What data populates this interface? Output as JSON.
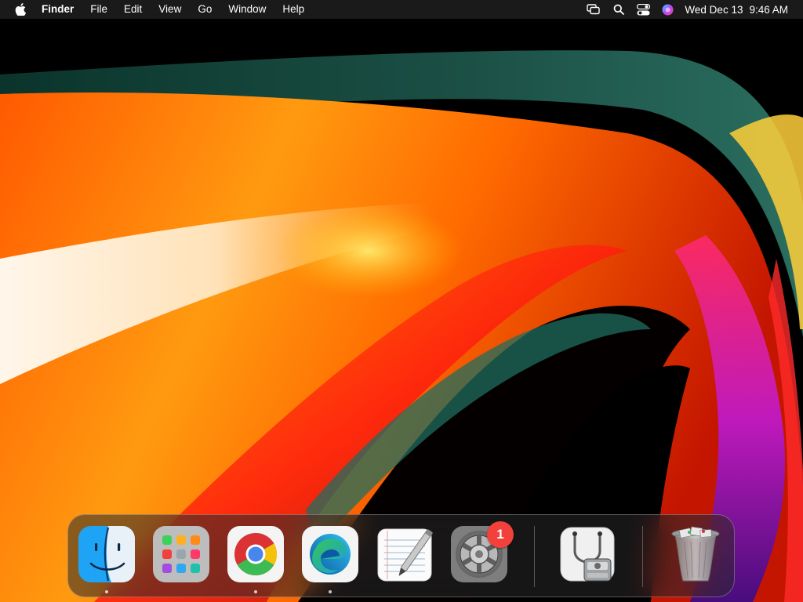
{
  "menubar": {
    "app_name": "Finder",
    "menus": [
      "File",
      "Edit",
      "View",
      "Go",
      "Window",
      "Help"
    ],
    "status_icons": [
      "screen-mirroring-icon",
      "search-icon",
      "control-center-icon",
      "siri-icon"
    ],
    "clock": {
      "day_date": "Wed Dec 13",
      "time": "9:46 AM"
    }
  },
  "dock": {
    "items": [
      {
        "id": "finder",
        "icon": "finder-icon",
        "running": true
      },
      {
        "id": "launchpad",
        "icon": "launchpad-icon",
        "running": false
      },
      {
        "id": "chrome",
        "icon": "chrome-icon",
        "running": true
      },
      {
        "id": "edge",
        "icon": "edge-icon",
        "running": true
      },
      {
        "id": "textedit",
        "icon": "textedit-icon",
        "running": false
      },
      {
        "id": "system-preferences",
        "icon": "system-preferences-icon",
        "running": false,
        "badge": "1"
      },
      {
        "id": "disk-utility",
        "icon": "disk-utility-icon",
        "running": false
      },
      {
        "id": "trash",
        "icon": "trash-icon",
        "running": false
      }
    ]
  },
  "colors": {
    "menubar_bg": "#1c1c1c",
    "badge": "#f2403a",
    "wallpaper_orange": "#ff8a00",
    "wallpaper_red": "#ff1e0e",
    "wallpaper_teal": "#1f5a4e"
  }
}
